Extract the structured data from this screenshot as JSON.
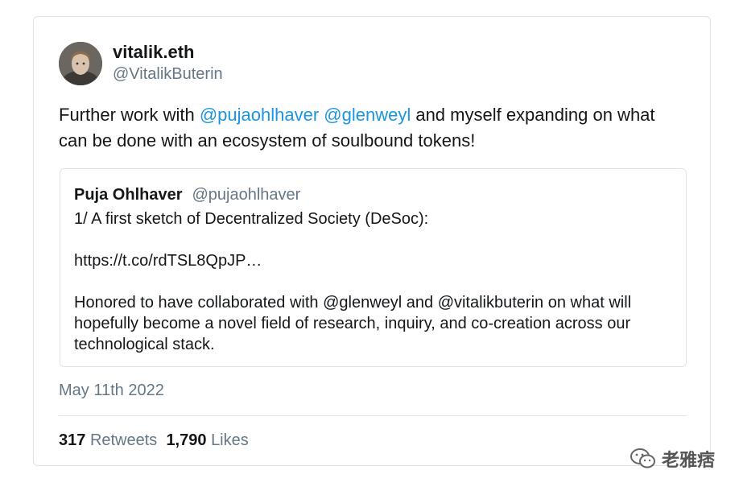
{
  "tweet": {
    "author_name": "vitalik.eth",
    "author_handle": "@VitalikButerin",
    "text_before": "Further work with ",
    "mention_1": "@pujaohlhaver",
    "text_space": " ",
    "mention_2": "@glenweyl",
    "text_after": " and myself expanding on what can be done with an ecosystem of soulbound tokens!",
    "date": "May 11th 2022"
  },
  "quoted_tweet": {
    "author_name": "Puja Ohlhaver",
    "author_handle": "@pujaohlhaver",
    "line_1": "1/ A first sketch of Decentralized Society (DeSoc):",
    "link": "https://t.co/rdTSL8QpJP…",
    "paragraph": "Honored to have collaborated with @glenweyl and @vitalikbuterin on what will hopefully become a novel field of research, inquiry, and co-creation across our technological stack."
  },
  "stats": {
    "retweets_count": "317",
    "retweets_label": "Retweets",
    "likes_count": "1,790",
    "likes_label": "Likes"
  },
  "watermark": {
    "text": "老雅痞",
    "icon": "wechat-icon"
  },
  "colors": {
    "mention": "#1b95e0",
    "secondary_text": "#657786",
    "border": "#dfe3e6"
  }
}
